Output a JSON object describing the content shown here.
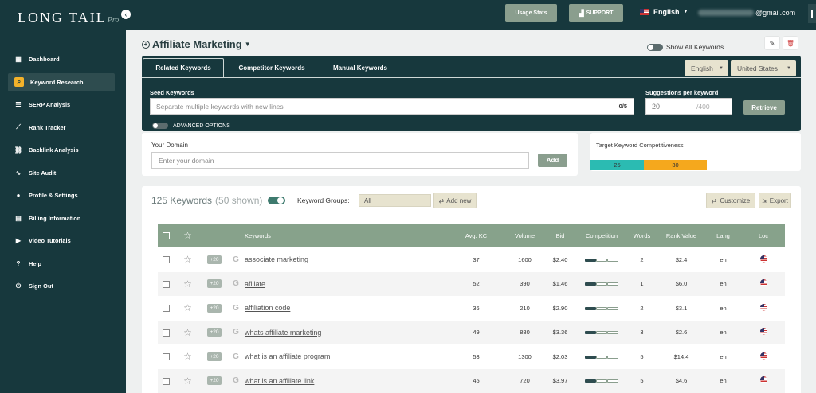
{
  "app": {
    "logo_text": "LONG TAIL",
    "logo_script": "Pro"
  },
  "sidebar": {
    "items": [
      {
        "label": "Dashboard",
        "icon": "dashboard-icon",
        "glyph": "▦"
      },
      {
        "label": "Keyword Research",
        "icon": "search-icon",
        "glyph": "⌕"
      },
      {
        "label": "SERP Analysis",
        "icon": "list-icon",
        "glyph": "☰"
      },
      {
        "label": "Rank Tracker",
        "icon": "chart-icon",
        "glyph": "⟋"
      },
      {
        "label": "Backlink Analysis",
        "icon": "link-icon",
        "glyph": "⛓"
      },
      {
        "label": "Site Audit",
        "icon": "audit-icon",
        "glyph": "∿"
      },
      {
        "label": "Profile & Settings",
        "icon": "user-icon",
        "glyph": "●"
      },
      {
        "label": "Billing Information",
        "icon": "billing-icon",
        "glyph": "▤"
      },
      {
        "label": "Video Tutorials",
        "icon": "video-icon",
        "glyph": "▶"
      },
      {
        "label": "Help",
        "icon": "help-icon",
        "glyph": "?"
      },
      {
        "label": "Sign Out",
        "icon": "power-icon",
        "glyph": "⏻"
      }
    ],
    "active_index": 1
  },
  "topbar": {
    "usage_stats": "Usage Stats",
    "support": "SUPPORT",
    "language": "English",
    "email_suffix": "@gmail.com"
  },
  "page": {
    "title": "Affiliate Marketing",
    "show_all_keywords": "Show All Keywords"
  },
  "tabs": [
    {
      "label": "Related Keywords",
      "active": true
    },
    {
      "label": "Competitor Keywords",
      "active": false
    },
    {
      "label": "Manual Keywords",
      "active": false
    }
  ],
  "filters": {
    "language": "English",
    "country": "United States"
  },
  "seed": {
    "label": "Seed Keywords",
    "placeholder": "Separate multiple keywords with new lines",
    "count": "0/5",
    "suggestions_label": "Suggestions per keyword",
    "suggestions_value": "20",
    "suggestions_max": "/400",
    "retrieve": "Retrieve",
    "advanced": "ADVANCED OPTIONS"
  },
  "domain": {
    "label": "Your Domain",
    "placeholder": "Enter your domain",
    "add": "Add"
  },
  "target_kc": {
    "label": "Target Keyword Competitiveness",
    "low": "25",
    "high": "30",
    "low_color": "#2bbbb2",
    "high_color": "#f5a81d"
  },
  "results": {
    "count_text": "125 Keywords",
    "shown_text": "(50 shown)",
    "groups_label": "Keyword Groups:",
    "groups_value": "All",
    "add_new": "Add new",
    "customize": "Customize",
    "export": "Export",
    "columns": [
      "Keywords",
      "Avg. KC",
      "Volume",
      "Bid",
      "Competition",
      "Words",
      "Rank Value",
      "Lang",
      "Loc"
    ],
    "plus_badge": "+20",
    "rows": [
      {
        "keyword": "associate marketing",
        "kc": "37",
        "volume": "1600",
        "bid": "$2.40",
        "competition": 0.3,
        "words": "2",
        "rank_value": "$2.4",
        "lang": "en"
      },
      {
        "keyword": "afiliate",
        "kc": "52",
        "volume": "390",
        "bid": "$1.46",
        "competition": 0.3,
        "words": "1",
        "rank_value": "$6.0",
        "lang": "en"
      },
      {
        "keyword": "affiliation code",
        "kc": "36",
        "volume": "210",
        "bid": "$2.90",
        "competition": 0.3,
        "words": "2",
        "rank_value": "$3.1",
        "lang": "en"
      },
      {
        "keyword": "whats affiliate marketing",
        "kc": "49",
        "volume": "880",
        "bid": "$3.36",
        "competition": 0.3,
        "words": "3",
        "rank_value": "$2.6",
        "lang": "en"
      },
      {
        "keyword": "what is an affiliate program",
        "kc": "53",
        "volume": "1300",
        "bid": "$2.03",
        "competition": 0.3,
        "words": "5",
        "rank_value": "$14.4",
        "lang": "en"
      },
      {
        "keyword": "what is an affiliate link",
        "kc": "45",
        "volume": "720",
        "bid": "$3.97",
        "competition": 0.3,
        "words": "5",
        "rank_value": "$4.6",
        "lang": "en"
      }
    ]
  }
}
